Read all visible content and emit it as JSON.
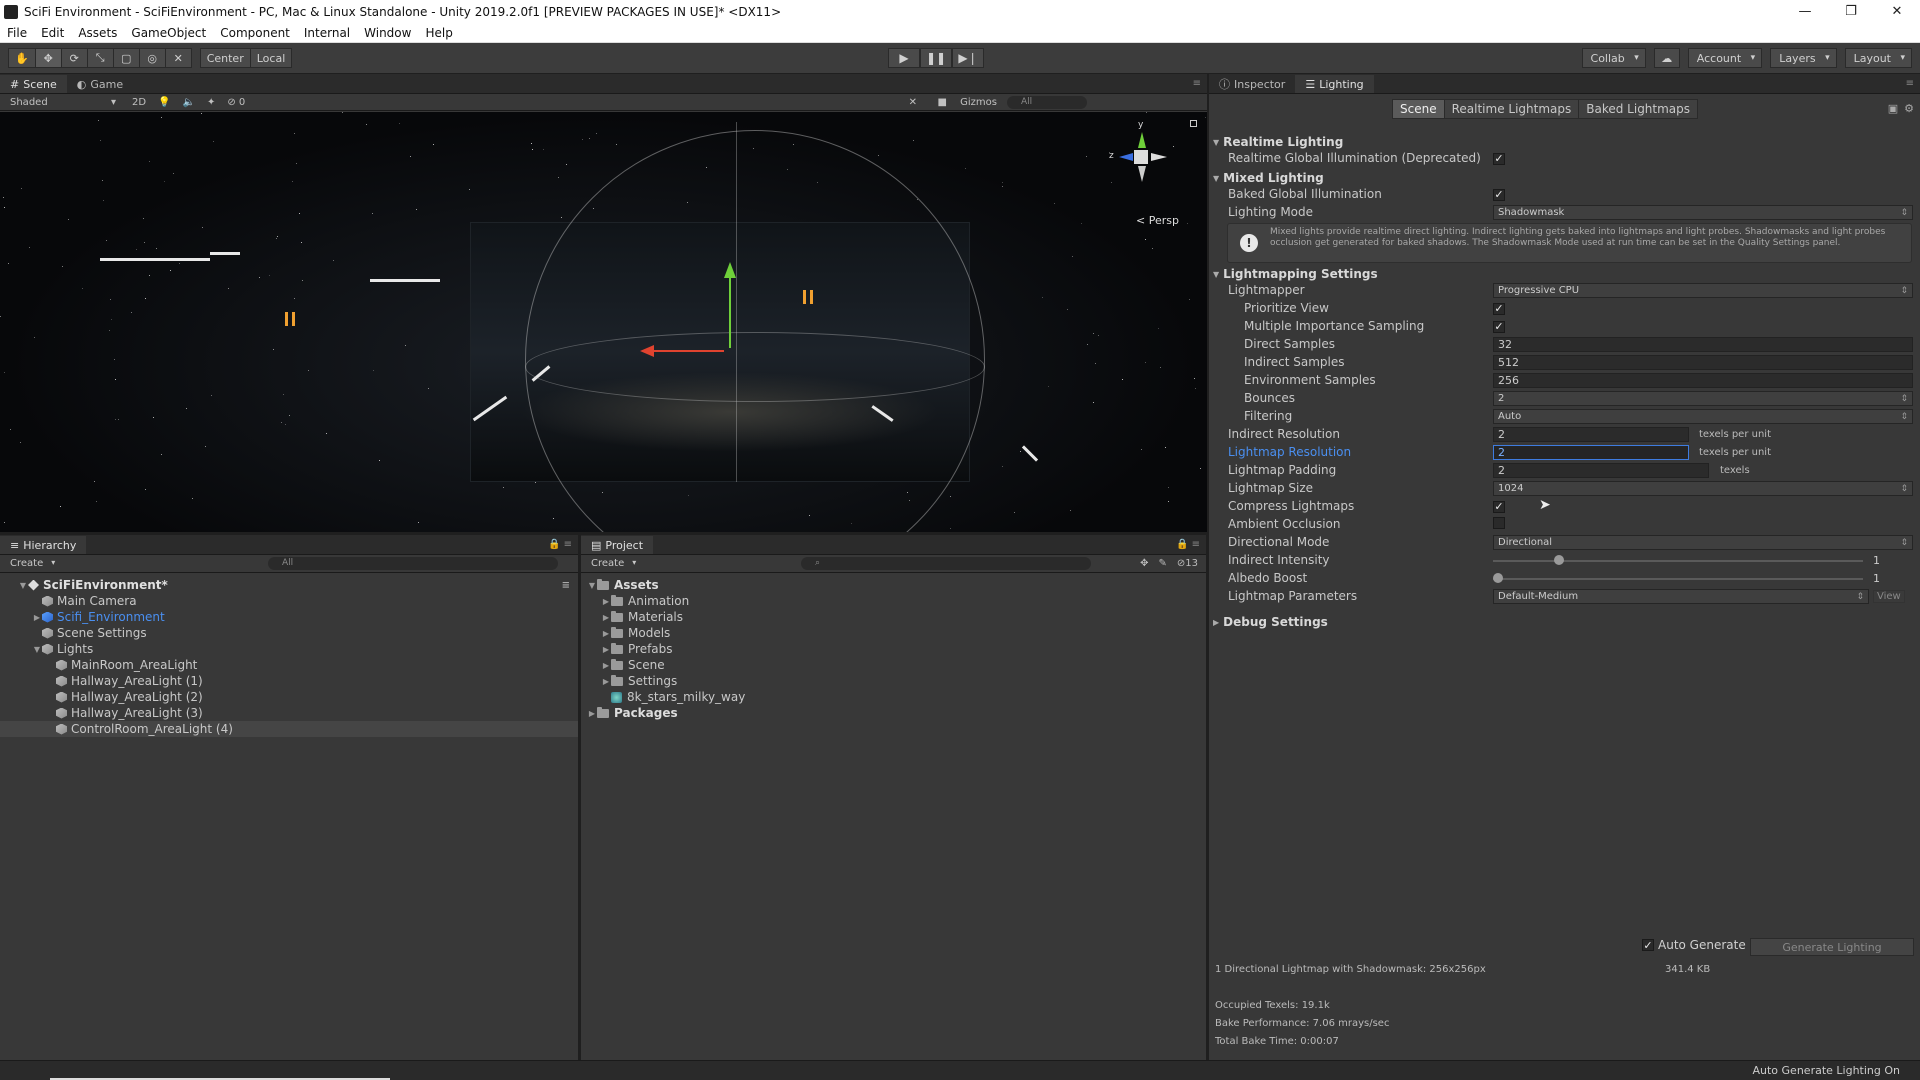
{
  "window": {
    "title": "SciFi Environment - SciFiEnvironment - PC, Mac & Linux Standalone - Unity 2019.2.0f1 [PREVIEW PACKAGES IN USE]* <DX11>",
    "controls": [
      "—",
      "❐",
      "✕"
    ]
  },
  "menubar": [
    "File",
    "Edit",
    "Assets",
    "GameObject",
    "Component",
    "Internal",
    "Window",
    "Help"
  ],
  "toolbar": {
    "tools": [
      "hand-tool",
      "move-tool",
      "rotate-tool",
      "scale-tool",
      "rect-tool",
      "transform-tool",
      "custom-tool"
    ],
    "pivot": "Center",
    "space": "Local",
    "play": "▶",
    "pause": "❚❚",
    "step": "▶❘",
    "collab": "Collab",
    "account": "Account",
    "layers": "Layers",
    "layout": "Layout"
  },
  "scene": {
    "tabs": [
      "Scene",
      "Game"
    ],
    "shading": "Shaded",
    "mode2d": "2D",
    "hidden_count": "0",
    "gizmos": "Gizmos",
    "search": "All",
    "persp": "Persp",
    "axis_y": "y",
    "axis_z": "z"
  },
  "hierarchy": {
    "tab": "Hierarchy",
    "create": "Create",
    "search": "All",
    "items": [
      {
        "label": "SciFiEnvironment*",
        "depth": 0,
        "type": "scene"
      },
      {
        "label": "Main Camera",
        "depth": 1,
        "type": "object"
      },
      {
        "label": "Scifi_Environment",
        "depth": 1,
        "type": "prefab"
      },
      {
        "label": "Scene Settings",
        "depth": 1,
        "type": "object"
      },
      {
        "label": "Lights",
        "depth": 1,
        "type": "object"
      },
      {
        "label": "MainRoom_AreaLight",
        "depth": 2,
        "type": "object"
      },
      {
        "label": "Hallway_AreaLight (1)",
        "depth": 2,
        "type": "object"
      },
      {
        "label": "Hallway_AreaLight (2)",
        "depth": 2,
        "type": "object"
      },
      {
        "label": "Hallway_AreaLight (3)",
        "depth": 2,
        "type": "object"
      },
      {
        "label": "ControlRoom_AreaLight (4)",
        "depth": 2,
        "type": "object"
      }
    ]
  },
  "project": {
    "tab": "Project",
    "create": "Create",
    "hidden_count": "13",
    "assets_label": "Assets",
    "folders": [
      "Animation",
      "Materials",
      "Models",
      "Prefabs",
      "Scene",
      "Settings"
    ],
    "skybox": "8k_stars_milky_way",
    "packages_label": "Packages"
  },
  "lighting": {
    "tabs": [
      "Inspector",
      "Lighting"
    ],
    "subtabs": [
      "Scene",
      "Realtime Lightmaps",
      "Baked Lightmaps"
    ],
    "realtime_header": "Realtime Lighting",
    "realtime_gi": "Realtime Global Illumination (Deprecated)",
    "mixed_header": "Mixed Lighting",
    "baked_gi": "Baked Global Illumination",
    "lighting_mode_label": "Lighting Mode",
    "lighting_mode": "Shadowmask",
    "help_text": "Mixed lights provide realtime direct lighting. Indirect lighting gets baked into lightmaps and light probes. Shadowmasks and light probes occlusion get generated for baked shadows. The Shadowmask Mode used at run time can be set in the Quality Settings panel.",
    "lm_header": "Lightmapping Settings",
    "lightmapper_label": "Lightmapper",
    "lightmapper": "Progressive CPU",
    "prioritize_view": "Prioritize View",
    "mis": "Multiple Importance Sampling",
    "direct_samples_label": "Direct Samples",
    "direct_samples": "32",
    "indirect_samples_label": "Indirect Samples",
    "indirect_samples": "512",
    "env_samples_label": "Environment Samples",
    "env_samples": "256",
    "bounces_label": "Bounces",
    "bounces": "2",
    "filtering_label": "Filtering",
    "filtering": "Auto",
    "indirect_res_label": "Indirect Resolution",
    "indirect_res": "2",
    "texels_per_unit": "texels per unit",
    "lightmap_res_label": "Lightmap Resolution",
    "lightmap_res": "2",
    "padding_label": "Lightmap Padding",
    "padding": "2",
    "texels": "texels",
    "size_label": "Lightmap Size",
    "size": "1024",
    "compress_label": "Compress Lightmaps",
    "ao_label": "Ambient Occlusion",
    "dir_mode_label": "Directional Mode",
    "dir_mode": "Directional",
    "indirect_intensity_label": "Indirect Intensity",
    "indirect_intensity": "1",
    "indirect_intensity_fraction": 0.17,
    "albedo_boost_label": "Albedo Boost",
    "albedo_boost": "1",
    "albedo_boost_fraction": 0.0,
    "params_label": "Lightmap Parameters",
    "params": "Default-Medium",
    "view_btn": "View",
    "debug_header": "Debug Settings",
    "auto_generate": "Auto Generate",
    "generate_btn": "Generate Lighting",
    "stats_line1": "1 Directional Lightmap with Shadowmask: 256x256px",
    "stats_size": "341.4 KB",
    "occupied": "Occupied Texels: 19.1k",
    "bake_perf": "Bake Performance: 7.06 mrays/sec",
    "bake_time": "Total Bake Time: 0:00:07"
  },
  "statusbar": {
    "text": "Auto Generate Lighting On"
  },
  "colors": {
    "accent_blue": "#4a8ff0",
    "gizmo_green": "#6fd03a",
    "gizmo_red": "#e0432f",
    "gizmo_blue": "#3a6ee0"
  }
}
